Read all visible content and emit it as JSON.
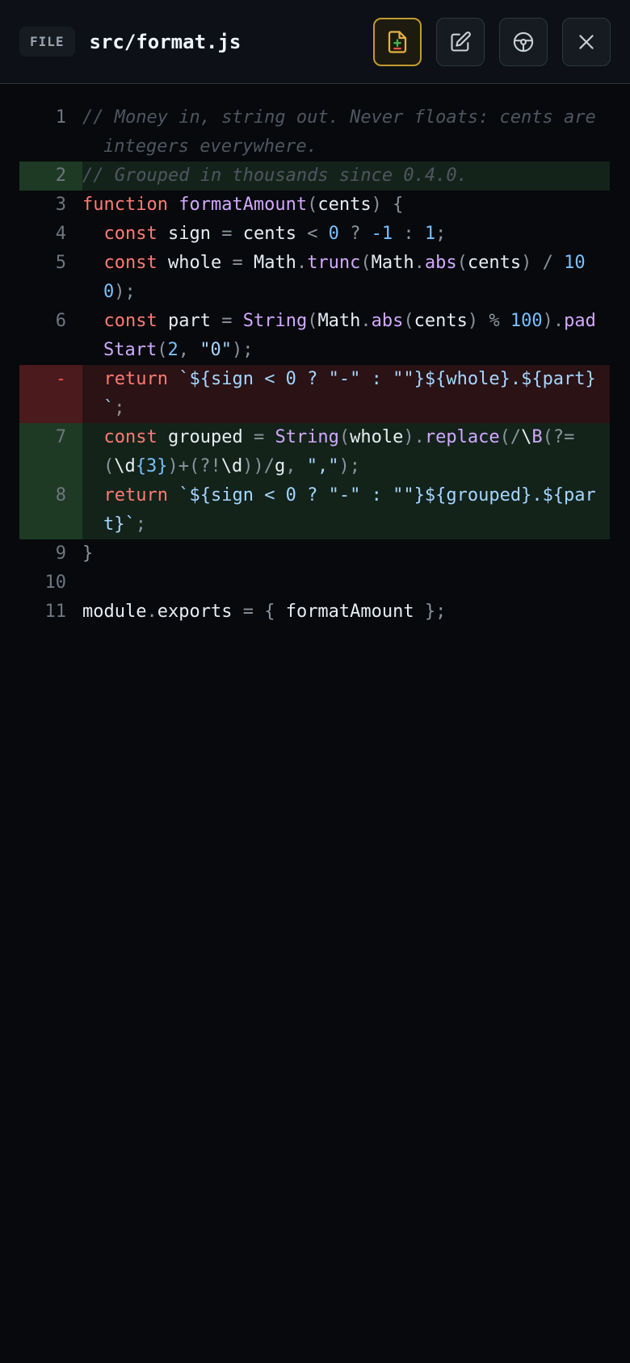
{
  "header": {
    "badge": "FILE",
    "path": "src/format.js"
  },
  "colors": {
    "accent": "#c39b2e",
    "added_bg": "#13231a",
    "removed_bg": "#2a1215"
  },
  "lines": [
    {
      "num": "1",
      "type": "ctx",
      "tokens": [
        {
          "t": "// Money in, string out. Never floats: cents are integers everywhere.",
          "c": "cm"
        }
      ]
    },
    {
      "num": "2",
      "type": "add",
      "tokens": [
        {
          "t": "// Grouped in thousands since 0.4.0.",
          "c": "cm"
        }
      ]
    },
    {
      "num": "3",
      "type": "ctx",
      "tokens": [
        {
          "t": "function",
          "c": "kw"
        },
        {
          "t": " ",
          "c": "id"
        },
        {
          "t": "formatAmount",
          "c": "fn"
        },
        {
          "t": "(",
          "c": "pu"
        },
        {
          "t": "cents",
          "c": "id"
        },
        {
          "t": ")",
          "c": "pu"
        },
        {
          "t": " {",
          "c": "pu"
        }
      ]
    },
    {
      "num": "4",
      "type": "ctx",
      "tokens": [
        {
          "t": "  const",
          "c": "kw"
        },
        {
          "t": " sign ",
          "c": "id"
        },
        {
          "t": "=",
          "c": "pu"
        },
        {
          "t": " cents ",
          "c": "id"
        },
        {
          "t": "<",
          "c": "pu"
        },
        {
          "t": " 0 ",
          "c": "nm"
        },
        {
          "t": "?",
          "c": "pu"
        },
        {
          "t": " -1 ",
          "c": "nm"
        },
        {
          "t": ":",
          "c": "pu"
        },
        {
          "t": " 1",
          "c": "nm"
        },
        {
          "t": ";",
          "c": "pu"
        }
      ]
    },
    {
      "num": "5",
      "type": "ctx",
      "tokens": [
        {
          "t": "  const",
          "c": "kw"
        },
        {
          "t": " whole ",
          "c": "id"
        },
        {
          "t": "=",
          "c": "pu"
        },
        {
          "t": " Math",
          "c": "id"
        },
        {
          "t": ".",
          "c": "pu"
        },
        {
          "t": "trunc",
          "c": "fn"
        },
        {
          "t": "(",
          "c": "pu"
        },
        {
          "t": "Math",
          "c": "id"
        },
        {
          "t": ".",
          "c": "pu"
        },
        {
          "t": "abs",
          "c": "fn"
        },
        {
          "t": "(",
          "c": "pu"
        },
        {
          "t": "cents",
          "c": "id"
        },
        {
          "t": ") / ",
          "c": "pu"
        },
        {
          "t": "100",
          "c": "nm"
        },
        {
          "t": ");",
          "c": "pu"
        }
      ]
    },
    {
      "num": "6",
      "type": "ctx",
      "tokens": [
        {
          "t": "  const",
          "c": "kw"
        },
        {
          "t": " part ",
          "c": "id"
        },
        {
          "t": "=",
          "c": "pu"
        },
        {
          "t": " String",
          "c": "fn"
        },
        {
          "t": "(",
          "c": "pu"
        },
        {
          "t": "Math",
          "c": "id"
        },
        {
          "t": ".",
          "c": "pu"
        },
        {
          "t": "abs",
          "c": "fn"
        },
        {
          "t": "(",
          "c": "pu"
        },
        {
          "t": "cents",
          "c": "id"
        },
        {
          "t": ") % ",
          "c": "pu"
        },
        {
          "t": "100",
          "c": "nm"
        },
        {
          "t": ").",
          "c": "pu"
        },
        {
          "t": "padStart",
          "c": "fn"
        },
        {
          "t": "(",
          "c": "pu"
        },
        {
          "t": "2",
          "c": "nm"
        },
        {
          "t": ", ",
          "c": "pu"
        },
        {
          "t": "\"0\"",
          "c": "st"
        },
        {
          "t": ");",
          "c": "pu"
        }
      ]
    },
    {
      "num": "-",
      "type": "del",
      "tokens": [
        {
          "t": "  return",
          "c": "kw"
        },
        {
          "t": " `${sign < 0 ? \"-\" : \"\"}${whole}.${part}`",
          "c": "st"
        },
        {
          "t": ";",
          "c": "pu"
        }
      ]
    },
    {
      "num": "7",
      "type": "add",
      "tokens": [
        {
          "t": "  const",
          "c": "kw"
        },
        {
          "t": " grouped ",
          "c": "id"
        },
        {
          "t": "=",
          "c": "pu"
        },
        {
          "t": " String",
          "c": "fn"
        },
        {
          "t": "(",
          "c": "pu"
        },
        {
          "t": "whole",
          "c": "id"
        },
        {
          "t": ").",
          "c": "pu"
        },
        {
          "t": "replace",
          "c": "fn"
        },
        {
          "t": "(/",
          "c": "pu"
        },
        {
          "t": "\\",
          "c": "id"
        },
        {
          "t": "B",
          "c": "fn"
        },
        {
          "t": "(?=(",
          "c": "pu"
        },
        {
          "t": "\\d",
          "c": "id"
        },
        {
          "t": "{3}",
          "c": "nm"
        },
        {
          "t": ")+(?!",
          "c": "pu"
        },
        {
          "t": "\\d",
          "c": "id"
        },
        {
          "t": "))/",
          "c": "pu"
        },
        {
          "t": "g",
          "c": "id"
        },
        {
          "t": ", ",
          "c": "pu"
        },
        {
          "t": "\",\"",
          "c": "st"
        },
        {
          "t": ");",
          "c": "pu"
        }
      ]
    },
    {
      "num": "8",
      "type": "add",
      "tokens": [
        {
          "t": "  return",
          "c": "kw"
        },
        {
          "t": " `${sign < 0 ? \"-\" : \"\"}${grouped}.${part}`",
          "c": "st"
        },
        {
          "t": ";",
          "c": "pu"
        }
      ]
    },
    {
      "num": "9",
      "type": "ctx",
      "tokens": [
        {
          "t": "}",
          "c": "pu"
        }
      ]
    },
    {
      "num": "10",
      "type": "ctx",
      "tokens": [
        {
          "t": " ",
          "c": "id"
        }
      ]
    },
    {
      "num": "11",
      "type": "ctx",
      "tokens": [
        {
          "t": "module",
          "c": "id"
        },
        {
          "t": ".",
          "c": "pu"
        },
        {
          "t": "exports ",
          "c": "id"
        },
        {
          "t": "= {",
          "c": "pu"
        },
        {
          "t": " formatAmount ",
          "c": "id"
        },
        {
          "t": "};",
          "c": "pu"
        }
      ]
    }
  ]
}
